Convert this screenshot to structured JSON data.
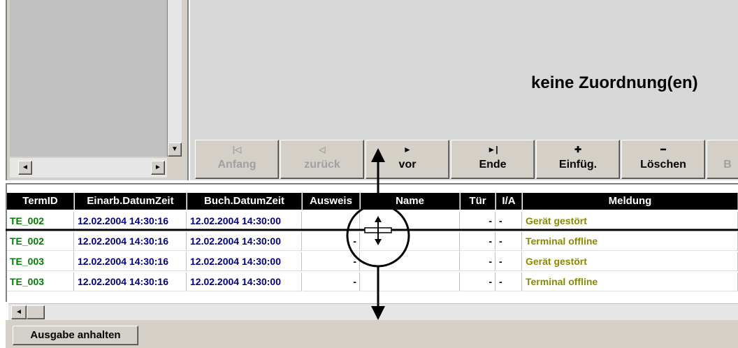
{
  "right_panel": {
    "assignment_text": "keine Zuordnung(en)"
  },
  "left_panel": {
    "scroll_down": "▼",
    "scroll_left": "◄",
    "scroll_right": "►"
  },
  "nav": [
    {
      "icon": "|◁",
      "label": "Anfang",
      "enabled": false
    },
    {
      "icon": "◁",
      "label": "zurück",
      "enabled": false
    },
    {
      "icon": "►",
      "label": "vor",
      "enabled": true
    },
    {
      "icon": "►|",
      "label": "Ende",
      "enabled": true
    },
    {
      "icon": "✚",
      "label": "Einfüg.",
      "enabled": true
    },
    {
      "icon": "━",
      "label": "Löschen",
      "enabled": true
    },
    {
      "icon": "",
      "label": "B",
      "enabled": false
    }
  ],
  "table": {
    "headers": [
      "TermID",
      "Einarb.DatumZeit",
      "Buch.DatumZeit",
      "Ausweis",
      "Name",
      "Tür",
      "I/A",
      "Meldung"
    ],
    "rows": [
      [
        "TE_002",
        "12.02.2004 14:30:16",
        "12.02.2004 14:30:00",
        "",
        "",
        "-",
        "-",
        "Gerät gestört"
      ],
      [
        "TE_002",
        "12.02.2004 14:30:16",
        "12.02.2004 14:30:00",
        "-",
        "",
        "-",
        "-",
        "Terminal offline"
      ],
      [
        "TE_003",
        "12.02.2004 14:30:16",
        "12.02.2004 14:30:00",
        "-",
        "",
        "-",
        "-",
        "Gerät gestört"
      ],
      [
        "TE_003",
        "12.02.2004 14:30:16",
        "12.02.2004 14:30:00",
        "-",
        "",
        "-",
        "-",
        "Terminal offline"
      ]
    ]
  },
  "bottom": {
    "scroll_left": "◄",
    "pause_button": "Ausgabe anhalten"
  },
  "colors": {
    "header_bg": "#000000",
    "termid": "#008000",
    "datetime": "#000080",
    "message": "#8a8a00"
  }
}
